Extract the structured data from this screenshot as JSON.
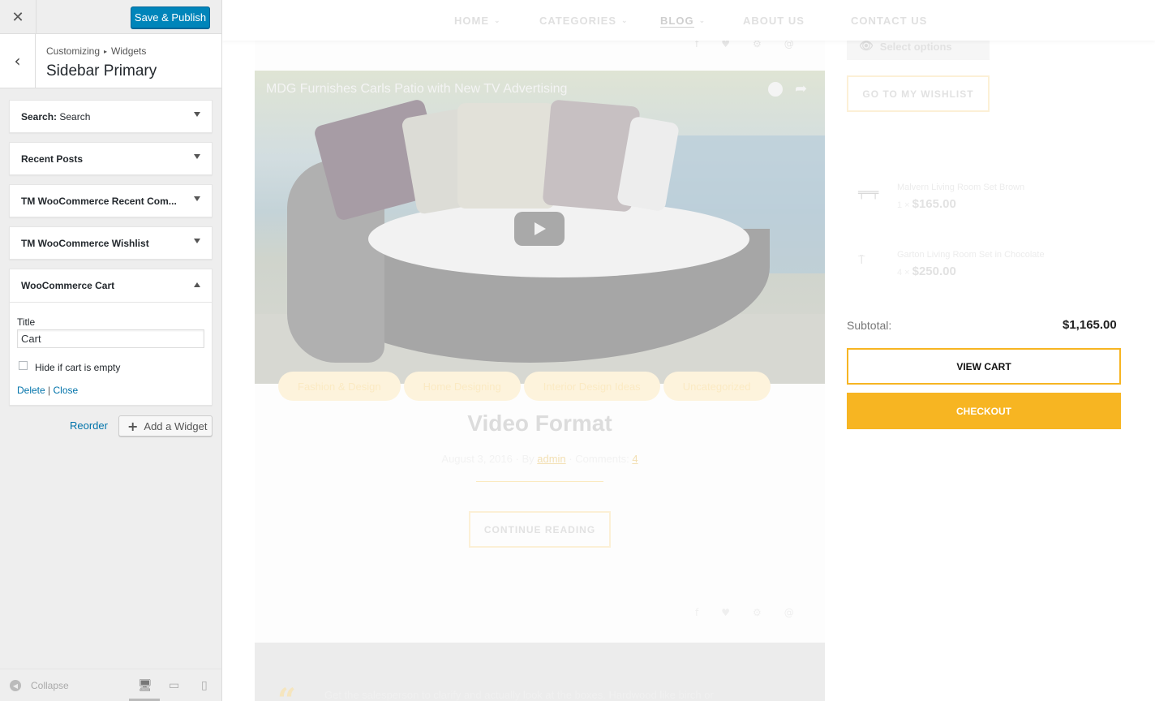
{
  "customizer": {
    "close_icon": "close-icon",
    "publish_label": "Save & Publish",
    "breadcrumb": [
      "Customizing",
      "Widgets"
    ],
    "section_title": "Sidebar Primary",
    "widgets": [
      {
        "label": "Search:",
        "sub": " Search"
      },
      {
        "label": "Recent Posts",
        "sub": ""
      },
      {
        "label": "TM WooCommerce Recent Com...",
        "sub": ""
      },
      {
        "label": "TM WooCommerce Wishlist",
        "sub": ""
      },
      {
        "label": "WooCommerce Cart",
        "sub": ""
      }
    ],
    "cart_widget": {
      "title_label": "Title",
      "title_value": "Cart",
      "hide_label": "Hide if cart is empty",
      "hide_checked": false,
      "delete_label": "Delete",
      "separator": "|",
      "close_label": "Close"
    },
    "reorder_label": "Reorder",
    "add_widget_label": "Add a Widget",
    "collapse_label": "Collapse",
    "devices": [
      "desktop-icon",
      "tablet-icon",
      "mobile-icon"
    ],
    "active_device": "desktop"
  },
  "preview": {
    "nav": [
      "HOME",
      "CATEGORIES",
      "BLOG",
      "ABOUT US",
      "CONTACT US"
    ],
    "active_nav": "BLOG",
    "video_title": "MDG Furnishes Carls Patio with New TV Advertising",
    "tags": [
      "Fashion & Design",
      "Home Designing",
      "Interior Design Ideas",
      "Uncategorized"
    ],
    "post_title": "Video Format",
    "meta": {
      "date": "August 3, 2016",
      "by_label": "By",
      "author": "admin",
      "comments_label": "Comments:",
      "comments_count": "4"
    },
    "continue_label": "CONTINUE READING",
    "quote_text": "Get the salesperson to clarify and actually look at the boxes. Hardwood like birch or",
    "select_options_label": "Select options",
    "wishlist_label": "GO TO MY WISHLIST",
    "cart_items": [
      {
        "name": "Malvern Living Room Set Brown",
        "qty": "1 ×",
        "price": "$165.00"
      },
      {
        "name": "Garton Living Room Set in Chocolate",
        "qty": "4 ×",
        "price": "$250.00"
      }
    ],
    "subtotal_label": "Subtotal:",
    "subtotal_value": "$1,165.00",
    "view_cart_label": "VIEW CART",
    "checkout_label": "CHECKOUT",
    "accent_color": "#f7b522",
    "wp_blue": "#0085ba"
  }
}
